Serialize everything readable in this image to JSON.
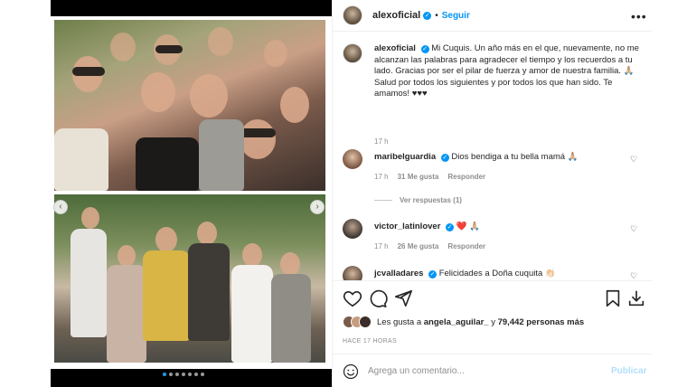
{
  "post": {
    "username": "alexoficial",
    "follow_label": "Seguir",
    "separator": "•",
    "more_icon": "more-horizontal-icon",
    "caption_user": "alexoficial",
    "caption_text": "Mi Cuquis. Un año más en el que, nuevamente, no me alcanzan las palabras para agradecer el tiempo y los recuerdos a tu lado. Gracias por ser el pilar de fuerza y amor de nuestra familia. 🙏🏼 Salud por todos los siguientes y por todos los que han sido. Te amamos! ♥♥♥",
    "caption_time": "17 h"
  },
  "comments": [
    {
      "user": "maribelguardia",
      "text": "Dios bendiga a tu bella mamá 🙏🏼",
      "time": "17 h",
      "likes": "31 Me gusta",
      "reply": "Responder",
      "view_replies": "Ver respuestas (1)"
    },
    {
      "user": "victor_latinlover",
      "text": "❤️ 🙏🏼",
      "time": "17 h",
      "likes": "26 Me gusta",
      "reply": "Responder"
    },
    {
      "user": "jcvalladares",
      "text": "Felicidades a Doña cuquita 👏🏻"
    }
  ],
  "actions": {
    "likes_prefix": "Les gusta a",
    "liker": "angela_aguilar_",
    "likes_mid": "y",
    "likes_count": "79,442 personas más",
    "time_ago": "HACE 17 HORAS",
    "comment_placeholder": "Agrega un comentario...",
    "post_label": "Publicar"
  },
  "colors": {
    "accent": "#0095f6",
    "muted": "#8e8e8e",
    "post_disabled": "#b2dffc"
  },
  "carousel": {
    "slides": 7,
    "active_slide": 1
  }
}
